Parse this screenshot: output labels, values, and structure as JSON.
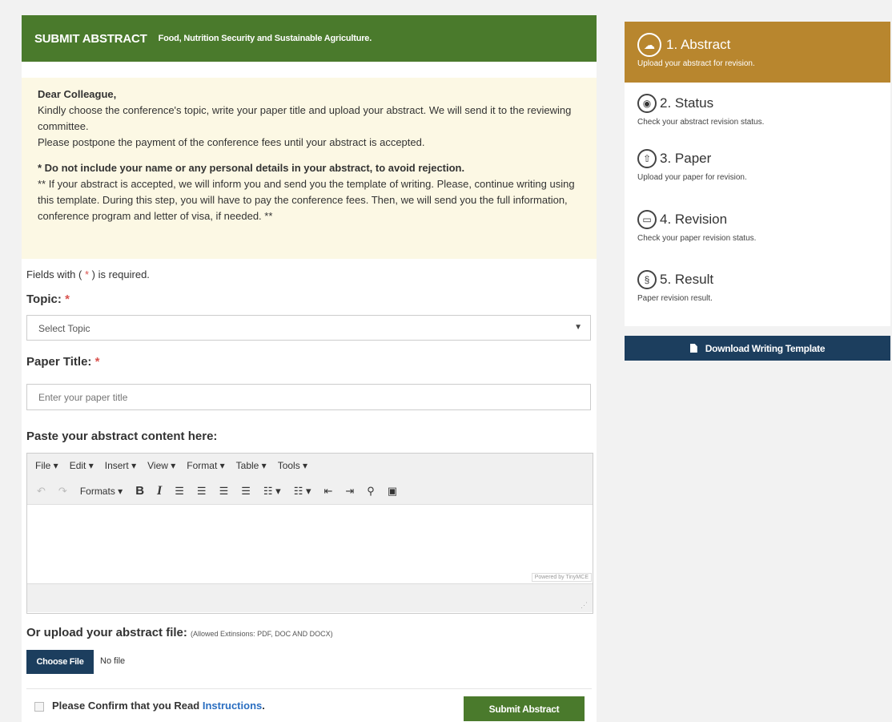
{
  "header": {
    "title": "SUBMIT ABSTRACT",
    "subtitle": "Food, Nutrition Security and Sustainable Agriculture."
  },
  "notice": {
    "greeting": "Dear Colleague,",
    "line1": "Kindly choose the conference's topic, write your paper title and upload your abstract. We will send it to the reviewing committee.",
    "line2": "Please postpone the payment of the conference fees until your abstract is accepted.",
    "warning": "* Do not include your name or any personal details in your abstract, to avoid rejection.",
    "line3": "** If your abstract is accepted, we will inform you and send you the template of writing. Please, continue writing using this template. During this step, you will have to pay the conference fees. Then, we will send you the full information, conference program and letter of visa, if needed. **"
  },
  "form": {
    "required_prefix": "Fields with (",
    "required_star": "*",
    "required_suffix": ") is required.",
    "topic_label": "Topic:",
    "topic_value": "Select Topic",
    "title_label": "Paper Title:",
    "title_placeholder": "Enter your paper title",
    "abstract_label": "Paste your abstract content here:",
    "upload_label": "Or upload your abstract file:",
    "upload_hint": "(Allowed Extinsions: PDF, DOC AND DOCX)",
    "choose_file": "Choose File",
    "no_file": "No file",
    "confirm_text": "Please Confirm that you Read",
    "confirm_link": "Instructions",
    "submit": "Submit Abstract"
  },
  "editor": {
    "menus": [
      "File ▾",
      "Edit ▾",
      "Insert ▾",
      "View ▾",
      "Format ▾",
      "Table ▾",
      "Tools ▾"
    ],
    "formats": "Formats ▾",
    "powered": "Powered by TinyMCE"
  },
  "steps": [
    {
      "title": "1. Abstract",
      "sub": "Upload your abstract for revision.",
      "icon": "cloud-upload-icon"
    },
    {
      "title": "2. Status",
      "sub": "Check your abstract revision status.",
      "icon": "eye-icon"
    },
    {
      "title": "3. Paper",
      "sub": "Upload your paper for revision.",
      "icon": "upload-icon"
    },
    {
      "title": "4. Revision",
      "sub": "Check your paper revision status.",
      "icon": "laptop-icon"
    },
    {
      "title": "5. Result",
      "sub": "Paper revision result.",
      "icon": "link-icon"
    }
  ],
  "download": "Download Writing Template",
  "colors": {
    "green": "#4a7a2c",
    "gold": "#b8862e",
    "navy": "#1c3e5e"
  }
}
